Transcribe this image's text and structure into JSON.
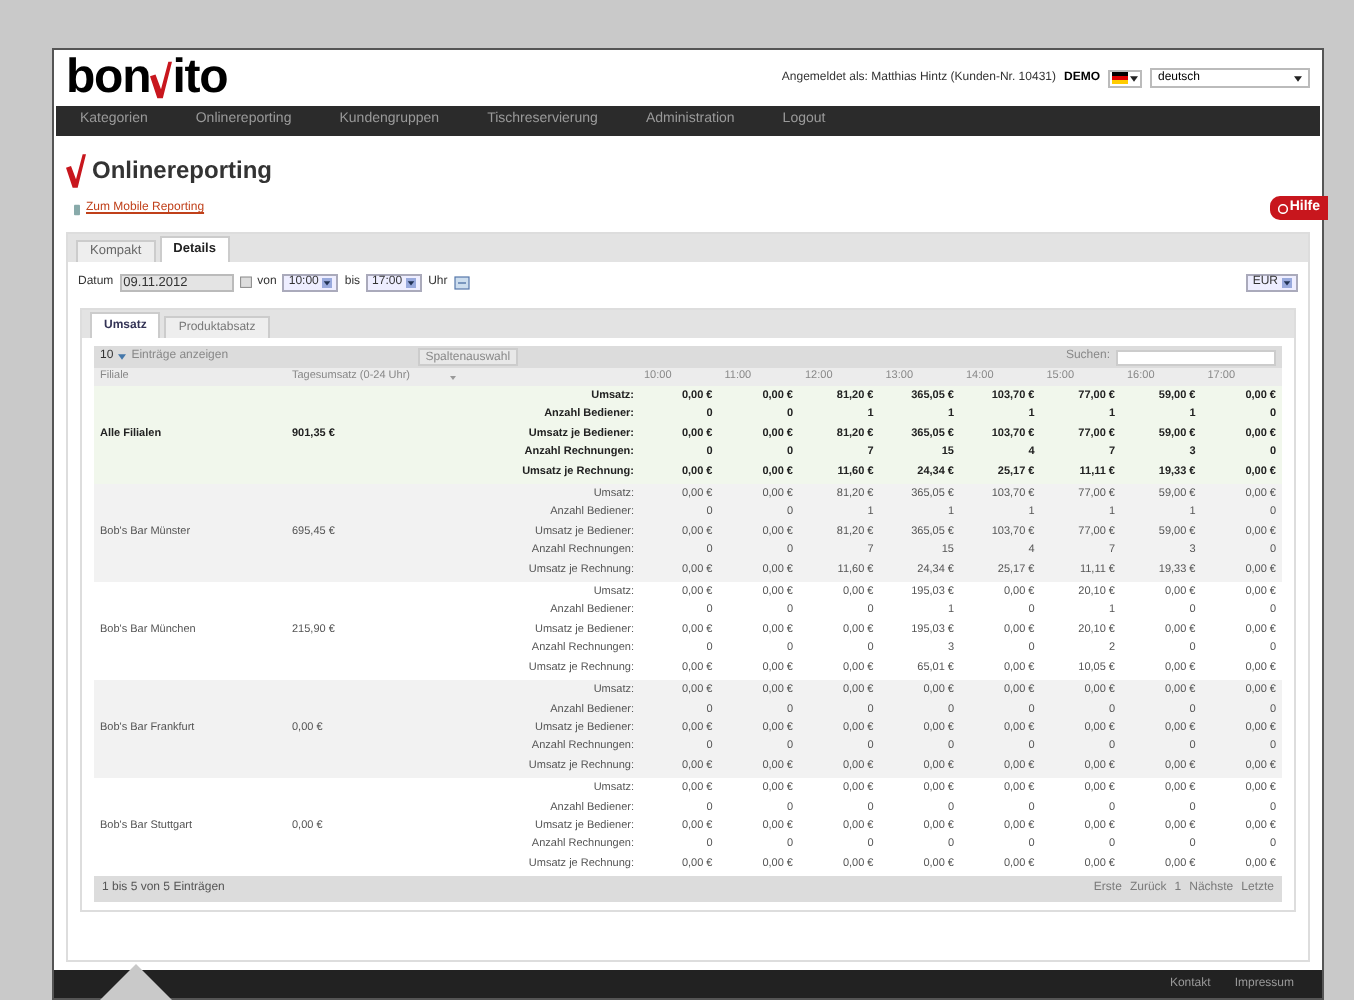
{
  "header": {
    "logo_start": "bon",
    "logo_end": "ito",
    "logged_in": "Angemeldet als: Matthias Hintz (Kunden-Nr. 10431)",
    "badge": "DEMO",
    "language": "deutsch"
  },
  "nav": [
    "Kategorien",
    "Onlinereporting",
    "Kundengruppen",
    "Tischreservierung",
    "Administration",
    "Logout"
  ],
  "page_title": "Onlinereporting",
  "mobile_link": "Zum Mobile Reporting",
  "help_button": "Hilfe",
  "tabs": [
    {
      "label": "Kompakt",
      "selected": false
    },
    {
      "label": "Details",
      "selected": true
    }
  ],
  "filter": {
    "date_label": "Datum",
    "date": "09.11.2012",
    "from_label": "von",
    "from": "10:00",
    "to_label": "bis",
    "to": "17:00",
    "unit": "Uhr",
    "currency": "EUR"
  },
  "subtabs": [
    {
      "label": "Umsatz",
      "selected": true
    },
    {
      "label": "Produktabsatz",
      "selected": false
    }
  ],
  "table": {
    "page_size": "10",
    "page_size_label": "Einträge anzeigen",
    "column_select": "Spaltenauswahl",
    "search_label": "Suchen:",
    "columns": [
      "Filiale",
      "Tagesumsatz (0-24 Uhr)",
      "10:00",
      "11:00",
      "12:00",
      "13:00",
      "14:00",
      "15:00",
      "16:00",
      "17:00"
    ],
    "rows": [
      {
        "kind": "total",
        "name": "Alle Filialen",
        "total": "901,35 €",
        "metrics": [
          {
            "label": "Umsatz:",
            "values": [
              "0,00 €",
              "0,00 €",
              "81,20 €",
              "365,05 €",
              "103,70 €",
              "77,00 €",
              "59,00 €",
              "0,00 €"
            ]
          },
          {
            "label": "Anzahl Bediener:",
            "values": [
              "0",
              "0",
              "1",
              "1",
              "1",
              "1",
              "1",
              "0"
            ]
          },
          {
            "label": "Umsatz je Bediener:",
            "values": [
              "0,00 €",
              "0,00 €",
              "81,20 €",
              "365,05 €",
              "103,70 €",
              "77,00 €",
              "59,00 €",
              "0,00 €"
            ]
          },
          {
            "label": "Anzahl Rechnungen:",
            "values": [
              "0",
              "0",
              "7",
              "15",
              "4",
              "7",
              "3",
              "0"
            ]
          },
          {
            "label": "Umsatz je Rechnung:",
            "values": [
              "0,00 €",
              "0,00 €",
              "11,60 €",
              "24,34 €",
              "25,17 €",
              "11,11 €",
              "19,33 €",
              "0,00 €"
            ]
          }
        ]
      },
      {
        "kind": "branch",
        "name": "Bob's Bar Münster",
        "total": "695,45 €",
        "metrics": [
          {
            "label": "Umsatz:",
            "values": [
              "0,00 €",
              "0,00 €",
              "81,20 €",
              "365,05 €",
              "103,70 €",
              "77,00 €",
              "59,00 €",
              "0,00 €"
            ]
          },
          {
            "label": "Anzahl Bediener:",
            "values": [
              "0",
              "0",
              "1",
              "1",
              "1",
              "1",
              "1",
              "0"
            ]
          },
          {
            "label": "Umsatz je Bediener:",
            "values": [
              "0,00 €",
              "0,00 €",
              "81,20 €",
              "365,05 €",
              "103,70 €",
              "77,00 €",
              "59,00 €",
              "0,00 €"
            ]
          },
          {
            "label": "Anzahl Rechnungen:",
            "values": [
              "0",
              "0",
              "7",
              "15",
              "4",
              "7",
              "3",
              "0"
            ]
          },
          {
            "label": "Umsatz je Rechnung:",
            "values": [
              "0,00 €",
              "0,00 €",
              "11,60 €",
              "24,34 €",
              "25,17 €",
              "11,11 €",
              "19,33 €",
              "0,00 €"
            ]
          }
        ]
      },
      {
        "kind": "branch",
        "name": "Bob's Bar München",
        "total": "215,90 €",
        "metrics": [
          {
            "label": "Umsatz:",
            "values": [
              "0,00 €",
              "0,00 €",
              "0,00 €",
              "195,03 €",
              "0,00 €",
              "20,10 €",
              "0,00 €",
              "0,00 €"
            ]
          },
          {
            "label": "Anzahl Bediener:",
            "values": [
              "0",
              "0",
              "0",
              "1",
              "0",
              "1",
              "0",
              "0"
            ]
          },
          {
            "label": "Umsatz je Bediener:",
            "values": [
              "0,00 €",
              "0,00 €",
              "0,00 €",
              "195,03 €",
              "0,00 €",
              "20,10 €",
              "0,00 €",
              "0,00 €"
            ]
          },
          {
            "label": "Anzahl Rechnungen:",
            "values": [
              "0",
              "0",
              "0",
              "3",
              "0",
              "2",
              "0",
              "0"
            ]
          },
          {
            "label": "Umsatz je Rechnung:",
            "values": [
              "0,00 €",
              "0,00 €",
              "0,00 €",
              "65,01 €",
              "0,00 €",
              "10,05 €",
              "0,00 €",
              "0,00 €"
            ]
          }
        ]
      },
      {
        "kind": "branch",
        "name": "Bob's Bar Frankfurt",
        "total": "0,00 €",
        "metrics": [
          {
            "label": "Umsatz:",
            "values": [
              "0,00 €",
              "0,00 €",
              "0,00 €",
              "0,00 €",
              "0,00 €",
              "0,00 €",
              "0,00 €",
              "0,00 €"
            ]
          },
          {
            "label": "Anzahl Bediener:",
            "values": [
              "0",
              "0",
              "0",
              "0",
              "0",
              "0",
              "0",
              "0"
            ]
          },
          {
            "label": "Umsatz je Bediener:",
            "values": [
              "0,00 €",
              "0,00 €",
              "0,00 €",
              "0,00 €",
              "0,00 €",
              "0,00 €",
              "0,00 €",
              "0,00 €"
            ]
          },
          {
            "label": "Anzahl Rechnungen:",
            "values": [
              "0",
              "0",
              "0",
              "0",
              "0",
              "0",
              "0",
              "0"
            ]
          },
          {
            "label": "Umsatz je Rechnung:",
            "values": [
              "0,00 €",
              "0,00 €",
              "0,00 €",
              "0,00 €",
              "0,00 €",
              "0,00 €",
              "0,00 €",
              "0,00 €"
            ]
          }
        ]
      },
      {
        "kind": "branch",
        "name": "Bob's Bar Stuttgart",
        "total": "0,00 €",
        "metrics": [
          {
            "label": "Umsatz:",
            "values": [
              "0,00 €",
              "0,00 €",
              "0,00 €",
              "0,00 €",
              "0,00 €",
              "0,00 €",
              "0,00 €",
              "0,00 €"
            ]
          },
          {
            "label": "Anzahl Bediener:",
            "values": [
              "0",
              "0",
              "0",
              "0",
              "0",
              "0",
              "0",
              "0"
            ]
          },
          {
            "label": "Umsatz je Bediener:",
            "values": [
              "0,00 €",
              "0,00 €",
              "0,00 €",
              "0,00 €",
              "0,00 €",
              "0,00 €",
              "0,00 €",
              "0,00 €"
            ]
          },
          {
            "label": "Anzahl Rechnungen:",
            "values": [
              "0",
              "0",
              "0",
              "0",
              "0",
              "0",
              "0",
              "0"
            ]
          },
          {
            "label": "Umsatz je Rechnung:",
            "values": [
              "0,00 €",
              "0,00 €",
              "0,00 €",
              "0,00 €",
              "0,00 €",
              "0,00 €",
              "0,00 €",
              "0,00 €"
            ]
          }
        ]
      }
    ],
    "info": "1 bis 5 von 5 Einträgen",
    "pagination": [
      {
        "label": "Erste",
        "disabled": true
      },
      {
        "label": "Zurück",
        "disabled": true
      },
      {
        "label": "1",
        "disabled": true
      },
      {
        "label": "Nächste",
        "disabled": true
      },
      {
        "label": "Letzte",
        "disabled": true
      }
    ]
  },
  "footer": [
    "Kontakt",
    "Impressum"
  ]
}
